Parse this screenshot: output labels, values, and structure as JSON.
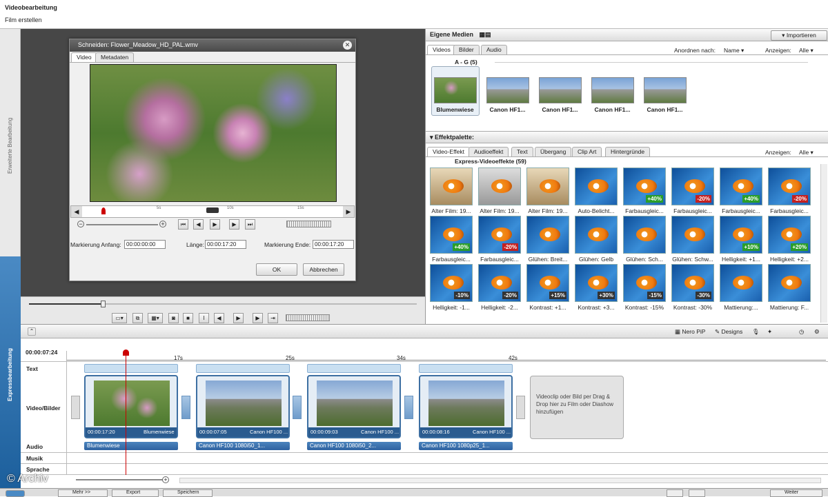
{
  "header": {
    "title": "Videobearbeitung",
    "subtitle": "Film erstellen"
  },
  "side": {
    "top": "Erweiterte Bearbeitung",
    "bottom": "Expressbearbeitung"
  },
  "dialog": {
    "title": "Schneiden: Flower_Meadow_HD_PAL.wmv",
    "tabs": [
      "Video",
      "Metadaten"
    ],
    "ruler": [
      "5s",
      "10s",
      "15s"
    ],
    "mark_start_label": "Markierung Anfang:",
    "mark_start": "00:00:00:00",
    "length_label": "Länge:",
    "length": "00:00:17:20",
    "mark_end_label": "Markierung Ende:",
    "mark_end": "00:00:17:20",
    "ok": "OK",
    "cancel": "Abbrechen"
  },
  "media": {
    "title": "Eigene Medien",
    "import": "Importieren",
    "tabs": [
      "Videos",
      "Bilder",
      "Audio"
    ],
    "sort_label": "Anordnen nach:",
    "sort_value": "Name",
    "show_label": "Anzeigen:",
    "show_value": "Alle",
    "group": "A - G (5)",
    "items": [
      "Blumenwiese",
      "Canon HF1...",
      "Canon HF1...",
      "Canon HF1...",
      "Canon HF1..."
    ]
  },
  "effects": {
    "title": "Effektpalette:",
    "tabs": [
      "Video-Effekt",
      "Audioeffekt",
      "Text",
      "Übergang",
      "Clip Art",
      "Hintergründe"
    ],
    "show_label": "Anzeigen:",
    "show_value": "Alle",
    "group": "Express-Videoeffekte (59)",
    "row1": [
      "Alter Film: 19...",
      "Alter Film: 19...",
      "Alter Film: 19...",
      "Auto-Belicht...",
      "Farbausgleic...",
      "Farbausgleic...",
      "Farbausgleic...",
      "Farbausgleic..."
    ],
    "row1_badges": [
      "",
      "",
      "",
      "",
      "+40%",
      "-20%",
      "+40%",
      "-20%"
    ],
    "row2": [
      "Farbausgleic...",
      "Farbausgleic...",
      "Glühen: Breit...",
      "Glühen: Gelb",
      "Glühen: Sch...",
      "Glühen: Schw...",
      "Helligkeit: +1...",
      "Helligkeit: +2..."
    ],
    "row2_badges": [
      "+40%",
      "-20%",
      "",
      "",
      "",
      "",
      "+10%",
      "+20%"
    ],
    "row3": [
      "Helligkeit: -1...",
      "Helligkeit: -2...",
      "Kontrast: +1...",
      "Kontrast: +3...",
      "Kontrast: -15%",
      "Kontrast: -30%",
      "Mattierung:...",
      "Mattierung: F..."
    ],
    "row3_badges": [
      "-10%",
      "-20%",
      "+15%",
      "+30%",
      "-15%",
      "-30%",
      "",
      ""
    ]
  },
  "timeline": {
    "nero_pip": "Nero PiP",
    "designs": "Designs",
    "timecode": "00:00:07:24",
    "ticks": [
      "17s",
      "25s",
      "34s",
      "42s"
    ],
    "tracks": [
      "Text",
      "Video/Bilder",
      "Audio",
      "Musik",
      "Sprache"
    ],
    "clips": [
      {
        "time": "00:00:17:20",
        "name": "Blumenwiese",
        "audio": "Blumenwiese"
      },
      {
        "time": "00:00:07:05",
        "name": "Canon HF100 ...",
        "audio": "Canon HF100 1080i50_1..."
      },
      {
        "time": "00:00:09:03",
        "name": "Canon HF100 ...",
        "audio": "Canon HF100 1080i50_2..."
      },
      {
        "time": "00:00:08:16",
        "name": "Canon HF100 ...",
        "audio": "Canon HF100 1080p25_1..."
      }
    ],
    "drop_hint": "Videoclip oder Bild per Drag & Drop hier zu Film oder Diashow hinzufügen"
  },
  "bottom": {
    "more": "Mehr >>",
    "export": "Export",
    "save": "Speichern",
    "next": "Weiter",
    "watermark": "© Archiv"
  }
}
